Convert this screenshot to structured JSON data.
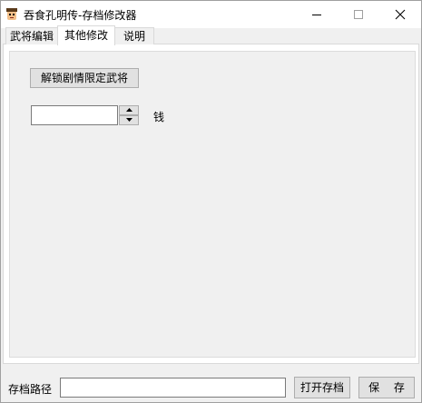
{
  "window": {
    "title": "吞食孔明传-存档修改器"
  },
  "tabs": [
    {
      "label": "武将编辑",
      "active": false
    },
    {
      "label": "其他修改",
      "active": true
    },
    {
      "label": "说明",
      "active": false
    }
  ],
  "other_tab": {
    "unlock_button": "解锁剧情限定武将",
    "money_label": "钱",
    "money_value": ""
  },
  "footer": {
    "path_label": "存档路径",
    "path_value": "",
    "open_button": "打开存档",
    "save_button": "保 存"
  },
  "icons": {
    "app": "app-icon",
    "minimize": "minimize-icon",
    "maximize": "maximize-icon",
    "close": "close-icon",
    "spin_up": "arrow-up-icon",
    "spin_down": "arrow-down-icon"
  },
  "colors": {
    "window_bg": "#f0f0f0",
    "titlebar_bg": "#ffffff",
    "button_bg": "#e1e1e1",
    "button_border": "#adadad"
  }
}
